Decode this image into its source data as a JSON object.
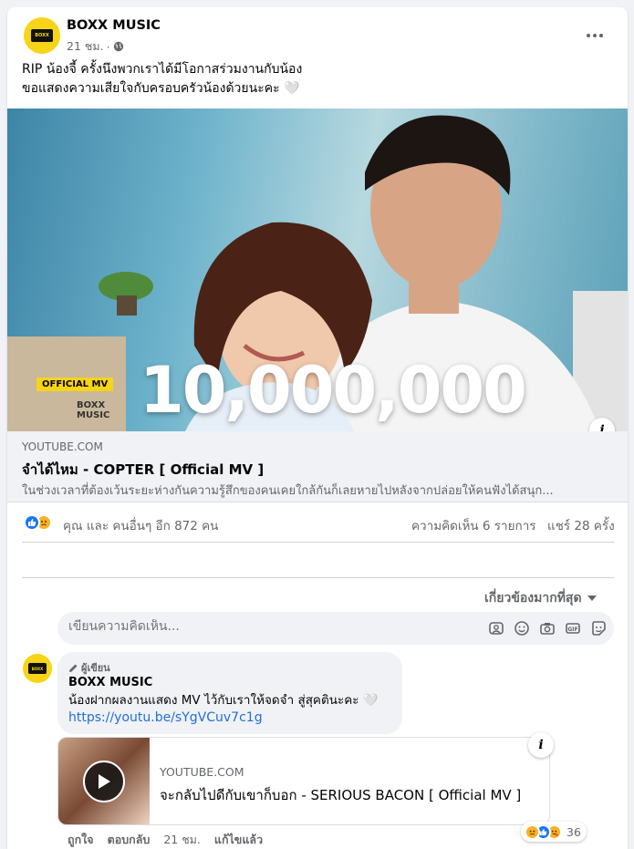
{
  "post": {
    "page_name": "BOXX MUSIC",
    "time": "21 ชม.",
    "separator": "·",
    "logo_text_1": "BOXX",
    "logo_text_2": "MUSIC",
    "text_line_1": "RIP น้องจี้ ครั้งนึงพวกเราได้มีโอกาสร่วมงานกับน้อง",
    "text_line_2": "ขอแสดงความเสียใจกับครอบครัวน้องด้วยนะคะ 🤍",
    "more_icon": "more-dots-icon"
  },
  "hero": {
    "badge": "OFFICIAL MV",
    "brand_1": "BOXX",
    "brand_2": "MUSIC",
    "big_number": "10,000,000"
  },
  "link": {
    "domain": "YOUTUBE.COM",
    "title": "จำได้ไหม - COPTER [ Official MV ]",
    "description": "ในช่วงเวลาที่ต้องเว้นระยะห่างกันความรู้สึกของคนเคยใกล้กันก็เลยหายไปหลังจากปล่อยให้คนฟังได้สนุก..."
  },
  "stats": {
    "reactions_text": "คุณ และ คนอื่นๆ อีก 872 คน",
    "comments_text": "ความคิดเห็น 6 รายการ",
    "shares_text": "แชร์ 28 ครั้ง"
  },
  "comments": {
    "sort_label": "เกี่ยวข้องมากที่สุด",
    "input_placeholder": "เขียนความคิดเห็น...",
    "top": {
      "badge": "ผู้เขียน",
      "author": "BOXX MUSIC",
      "text": "น้องฝากผลงานแสดง MV ไว้กับเราให้จดจำ สู่สุคตินะคะ 🤍",
      "link": "https://youtu.be/sYgVCuv7c1g",
      "preview_domain": "YOUTUBE.COM",
      "preview_title": "จะกลับไปดีกับเขาก็บอก - SERIOUS BACON [ Official MV ]",
      "like_action": "ถูกใจ",
      "reply_action": "ตอบกลับ",
      "time": "21 ชม.",
      "edited": "แก้ไขแล้ว",
      "reaction_count": "36"
    }
  },
  "colors": {
    "like_blue": "#1877f2",
    "sad_yellow": "#f7b125",
    "link_blue": "#216fdb",
    "brand_yellow": "#f7d417"
  }
}
